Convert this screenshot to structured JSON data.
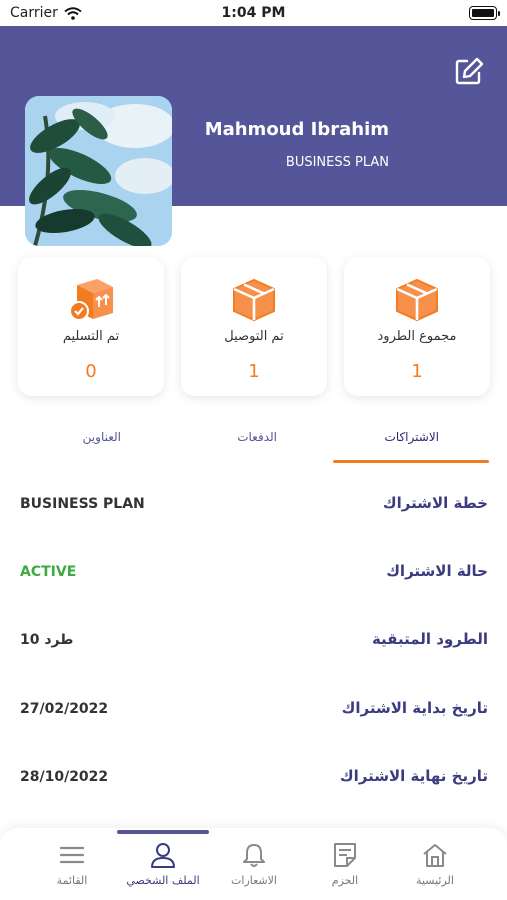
{
  "status_bar": {
    "carrier": "Carrier",
    "time": "1:04 PM"
  },
  "profile": {
    "name": "Mahmoud Ibrahim",
    "plan": "BUSINESS PLAN"
  },
  "stats": [
    {
      "label": "مجموع الطرود",
      "value": "1",
      "icon": "box-icon"
    },
    {
      "label": "تم التوصيل",
      "value": "1",
      "icon": "box-icon"
    },
    {
      "label": "تم التسليم",
      "value": "0",
      "icon": "delivered-box-icon"
    }
  ],
  "tabs": [
    {
      "label": "الاشتراكات",
      "active": true
    },
    {
      "label": "الدفعات",
      "active": false
    },
    {
      "label": "العناوين",
      "active": false
    }
  ],
  "subscription": [
    {
      "label": "خطة الاشتراك",
      "value": "BUSINESS PLAN"
    },
    {
      "label": "حالة الاشتراك",
      "value": "ACTIVE"
    },
    {
      "label": "الطرود المتبقية",
      "value": "10 طرد"
    },
    {
      "label": "تاريخ بداية الاشتراك",
      "value": "27/02/2022"
    },
    {
      "label": "تاريخ نهاية الاشتراك",
      "value": "28/10/2022"
    }
  ],
  "bottom_nav": [
    {
      "label": "الرئيسية",
      "icon": "home-icon",
      "active": false
    },
    {
      "label": "الحزم",
      "icon": "packages-icon",
      "active": false
    },
    {
      "label": "الاشعارات",
      "icon": "bell-icon",
      "active": false
    },
    {
      "label": "الملف الشخصي",
      "icon": "profile-icon",
      "active": true
    },
    {
      "label": "القائمة",
      "icon": "menu-icon",
      "active": false
    }
  ],
  "colors": {
    "primary": "#55559a",
    "accent": "#f47c20",
    "active_status": "#3daa3f"
  }
}
